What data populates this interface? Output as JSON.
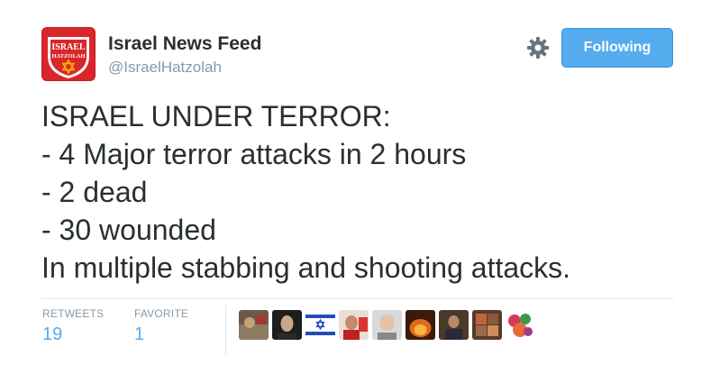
{
  "author": {
    "display_name": "Israel News Feed",
    "handle": "@IsraelHatzolah",
    "avatar_text_top": "ISRAEL",
    "avatar_text_bottom": "HATZOLAH"
  },
  "actions": {
    "follow_label": "Following",
    "settings_icon": "gear-icon"
  },
  "tweet": {
    "lines": [
      "ISRAEL UNDER TERROR:",
      "- 4 Major terror attacks in 2 hours",
      "- 2 dead",
      "- 30 wounded",
      "In multiple stabbing and shooting attacks."
    ]
  },
  "stats": {
    "retweets_label": "RETWEETS",
    "retweets_count": "19",
    "favorites_label": "FAVORITE",
    "favorites_count": "1"
  },
  "engagement_avatars": [
    "avatar-1",
    "avatar-2",
    "avatar-israel-flag",
    "avatar-4",
    "avatar-5",
    "avatar-6",
    "avatar-7",
    "avatar-8",
    "avatar-9"
  ],
  "colors": {
    "accent": "#55acee",
    "text": "#292f33",
    "muted": "#8899a6",
    "avatar_red": "#d9262a"
  }
}
